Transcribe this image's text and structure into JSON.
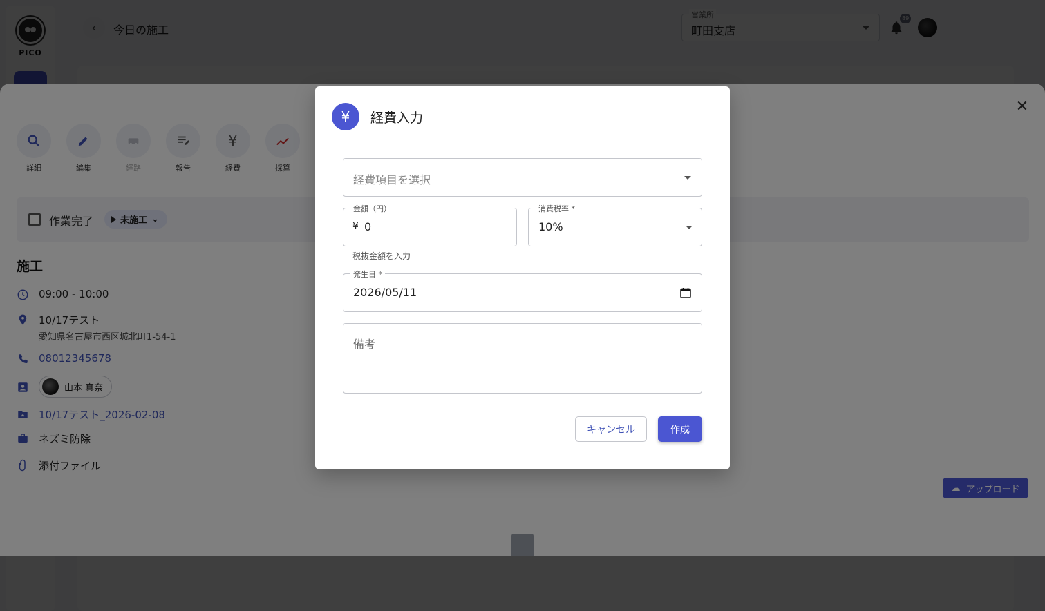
{
  "app": {
    "logo_text": "PICO"
  },
  "header": {
    "title": "今日の施工",
    "office_label": "営業所",
    "office_value": "町田支店",
    "notification_count": "89"
  },
  "drawer": {
    "actions": [
      {
        "label": "詳細",
        "icon": "search-icon",
        "enabled": true
      },
      {
        "label": "編集",
        "icon": "pencil-icon",
        "enabled": true
      },
      {
        "label": "経路",
        "icon": "car-icon",
        "enabled": false
      },
      {
        "label": "報告",
        "icon": "report-icon",
        "enabled": true
      },
      {
        "label": "経費",
        "icon": "yen-icon",
        "enabled": true
      },
      {
        "label": "採算",
        "icon": "trend-icon",
        "enabled": true
      }
    ],
    "work_done_label": "作業完了",
    "status_label": "未施工",
    "section_title": "施工",
    "time": "09:00 - 10:00",
    "site_name": "10/17テスト",
    "address": "愛知県名古屋市西区城北町1-54-1",
    "phone": "08012345678",
    "staff_name": "山本 真奈",
    "project_link": "10/17テスト_2026-02-08",
    "service": "ネズミ防除",
    "attachments_label": "添付ファイル",
    "upload_label": "アップロード"
  },
  "modal": {
    "title": "経費入力",
    "yen_symbol": "¥",
    "expense_item_placeholder": "経費項目を選択",
    "amount_label": "金額（円）",
    "amount_prefix": "¥",
    "amount_value": "0",
    "amount_helper": "税抜金額を入力",
    "tax_label": "消費税率 *",
    "tax_value": "10%",
    "date_label": "発生日 *",
    "date_value": "2026/05/11",
    "notes_placeholder": "備考",
    "cancel_label": "キャンセル",
    "create_label": "作成"
  },
  "colors": {
    "accent": "#4b56d2",
    "link": "#3f51b5"
  }
}
